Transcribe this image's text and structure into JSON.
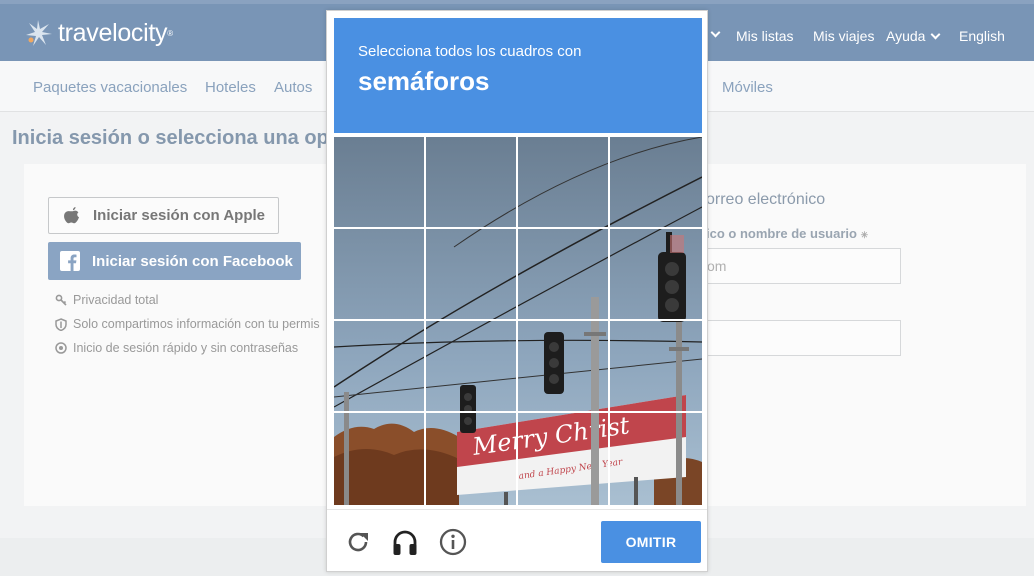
{
  "header": {
    "logo_text": "travelocity",
    "logo_tm": "®",
    "links": [
      {
        "label": "Mis listas",
        "icon": "none"
      },
      {
        "label": "Mis viajes",
        "icon": "none"
      },
      {
        "label": "Ayuda",
        "icon": "chevron-down-icon"
      },
      {
        "label": "English",
        "icon": "none"
      }
    ]
  },
  "nav": {
    "items": [
      "Paquetes vacacionales",
      "Hoteles",
      "Autos",
      "Móviles"
    ]
  },
  "main": {
    "title": "Inicia sesión o selecciona una op",
    "apple_button": "Iniciar sesión con Apple",
    "facebook_button": "Iniciar sesión con Facebook",
    "benefits": [
      {
        "icon": "key-icon",
        "text": "Privacidad total"
      },
      {
        "icon": "shield-icon",
        "text": "Solo compartimos información con tu permis"
      },
      {
        "icon": "target-icon",
        "text": "Inicio de sesión rápido y sin contraseñas"
      }
    ],
    "email_section_title": "orreo electrónico",
    "username_label": "ico o nombre de usuario",
    "required_mark": "✳",
    "username_placeholder": "om"
  },
  "captcha": {
    "prompt": "Selecciona todos los cuadros con",
    "object": "semáforos",
    "billboard_text": "Merry Christ",
    "billboard_subtext": "and a Happy New Year",
    "skip_label": "OMITIR",
    "footer_icons": [
      "refresh-icon",
      "audio-challenge-icon",
      "info-icon"
    ]
  },
  "colors": {
    "header_bg": "#7995b6",
    "captcha_blue": "#4a90e2",
    "facebook_bg": "#8aa4c3"
  }
}
